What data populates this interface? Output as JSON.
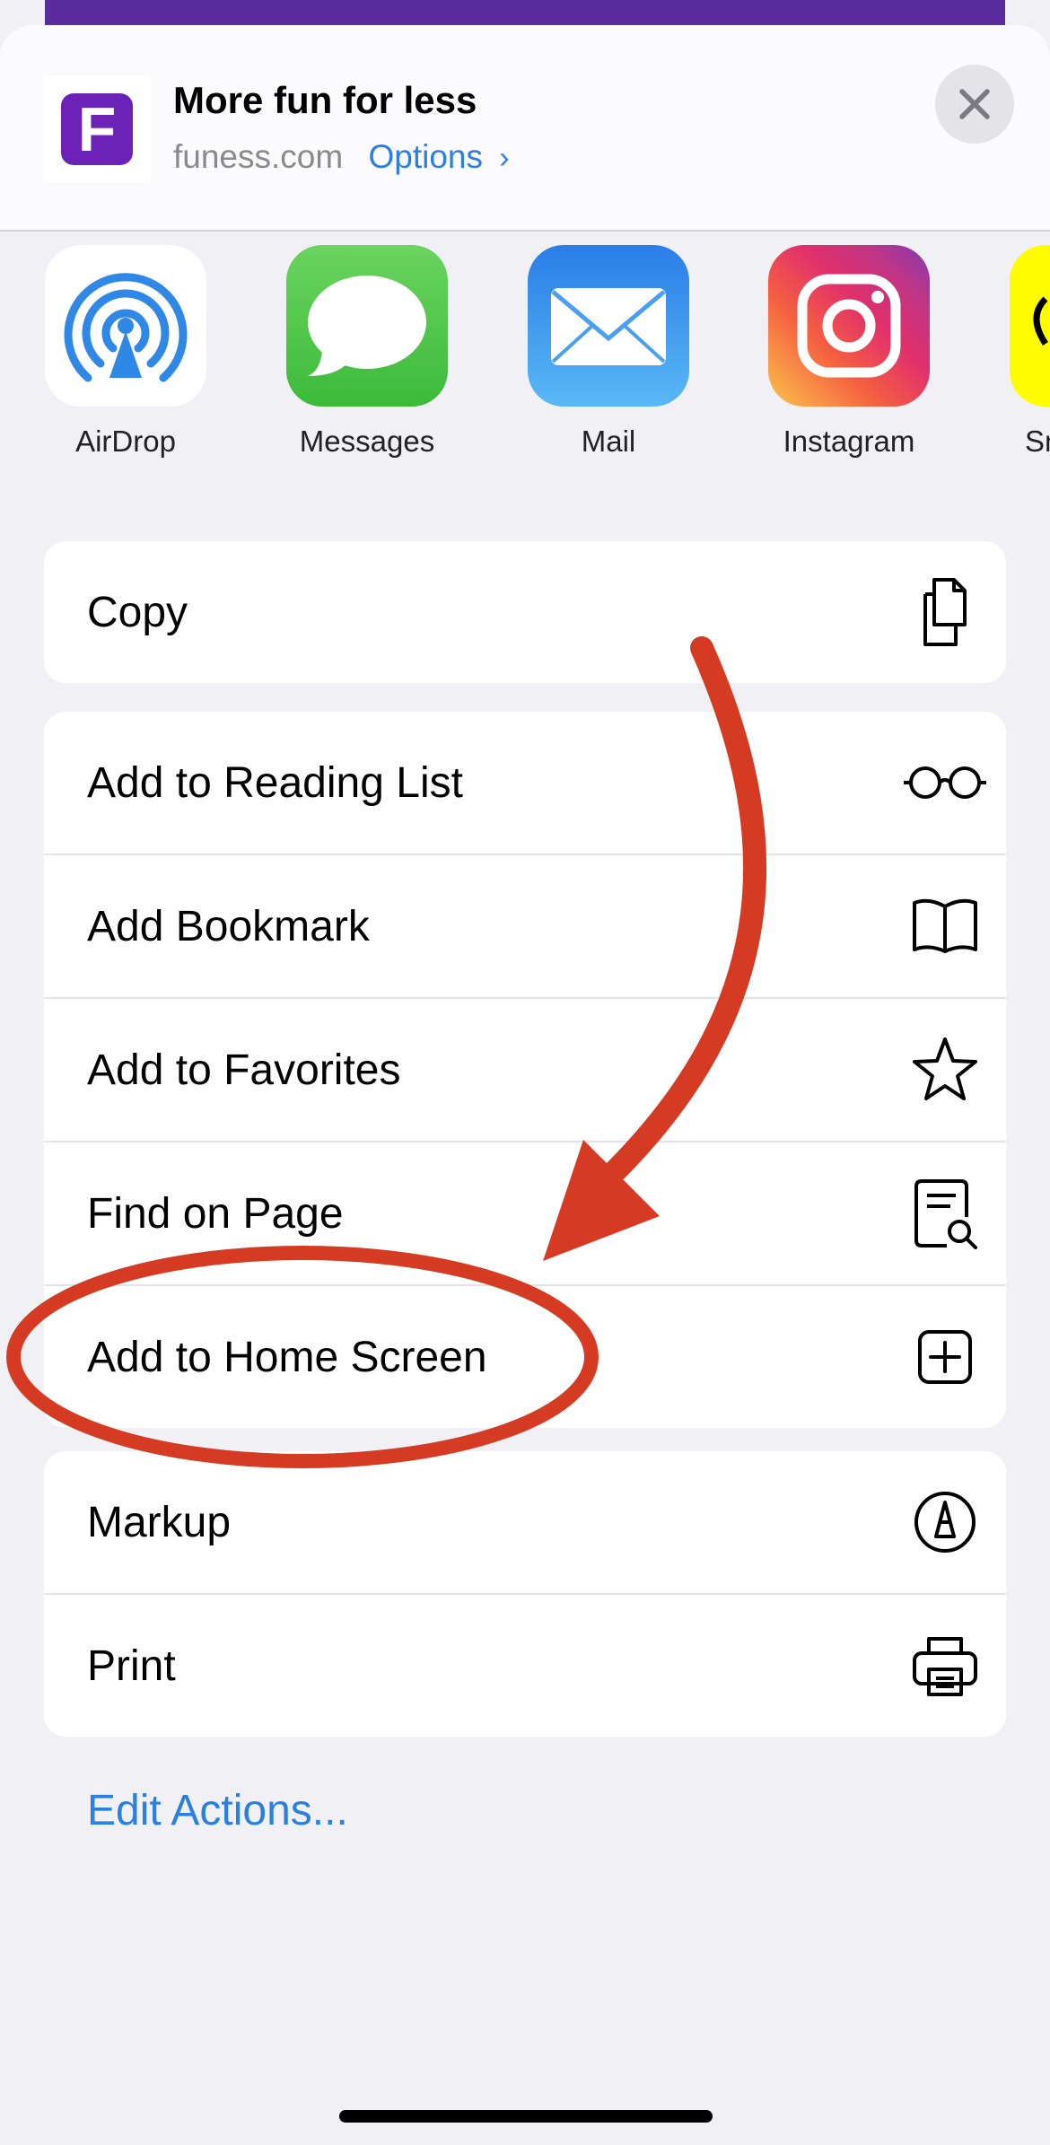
{
  "header": {
    "site_icon_letter": "F",
    "title": "More fun for less",
    "domain": "funess.com",
    "options_label": "Options",
    "options_chevron": "›",
    "close_icon": "close-icon"
  },
  "apps": [
    {
      "label": "AirDrop",
      "icon": "airdrop-icon"
    },
    {
      "label": "Messages",
      "icon": "messages-icon"
    },
    {
      "label": "Mail",
      "icon": "mail-icon"
    },
    {
      "label": "Instagram",
      "icon": "instagram-icon"
    },
    {
      "label": "Sn",
      "icon": "snapchat-icon"
    }
  ],
  "actions": {
    "group1": [
      {
        "label": "Copy",
        "icon": "copy-icon"
      }
    ],
    "group2": [
      {
        "label": "Add to Reading List",
        "icon": "glasses-icon"
      },
      {
        "label": "Add Bookmark",
        "icon": "book-icon"
      },
      {
        "label": "Add to Favorites",
        "icon": "star-icon"
      },
      {
        "label": "Find on Page",
        "icon": "find-icon"
      },
      {
        "label": "Add to Home Screen",
        "icon": "plus-square-icon"
      }
    ],
    "group3": [
      {
        "label": "Markup",
        "icon": "markup-icon"
      },
      {
        "label": "Print",
        "icon": "printer-icon"
      }
    ]
  },
  "edit_actions_label": "Edit Actions...",
  "colors": {
    "accent": "#2b7fe0",
    "annotation": "#d43b22",
    "site_brand": "#6c22b7"
  }
}
